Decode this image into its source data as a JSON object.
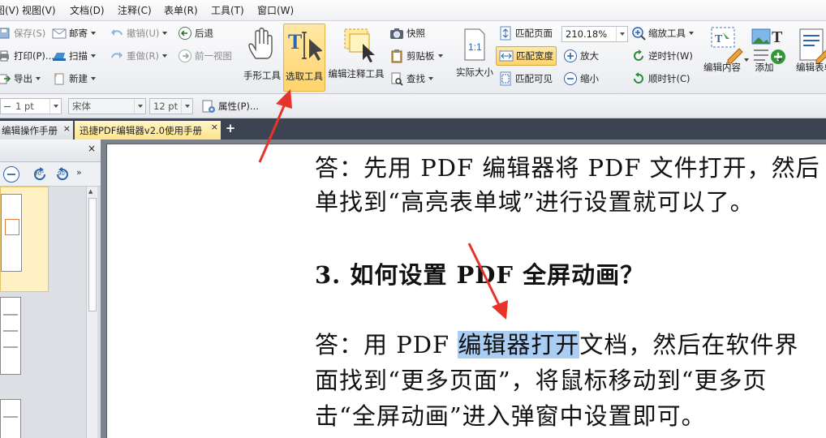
{
  "menubar": {
    "items": [
      "图(V)",
      "视图(V)",
      "文档(D)",
      "注释(C)",
      "表单(R)",
      "工具(T)",
      "窗口(W)"
    ]
  },
  "ribbon": {
    "file": {
      "save": "保存(S)",
      "print": "打印(P)...",
      "export": "导出",
      "mail": "邮寄",
      "scan": "扫描",
      "new": "新建"
    },
    "history": {
      "undo": "撤销(U)",
      "redo": "重做(R)",
      "back": "后退",
      "prev_view": "前一视图"
    },
    "tools": {
      "hand": "手形工具",
      "select": "选取工具",
      "annot_select": "编辑注释工具"
    },
    "clip": {
      "snapshot": "快照",
      "clipboard": "剪贴板",
      "find": "查找"
    },
    "view": {
      "actual_size": "实际大小",
      "fit_page": "匹配页面",
      "fit_width": "匹配宽度",
      "fit_visible": "匹配可见",
      "zoom_value": "210.18%",
      "zoom_tool": "缩放工具",
      "zoom_in": "放大",
      "zoom_out": "缩小",
      "rotate_ccw": "逆时针(W)",
      "rotate_cw": "顺时针(C)"
    },
    "edit": {
      "edit_content": "编辑内容",
      "add": "添加",
      "edit_form": "编辑表单"
    }
  },
  "props": {
    "line_width": "1 pt",
    "font": "宋体",
    "font_size": "12 pt",
    "properties": "属性(P)..."
  },
  "tabs": [
    {
      "label": "编辑操作手册",
      "active": false
    },
    {
      "label": "迅捷PDF编辑器v2.0使用手册",
      "active": true
    }
  ],
  "sidepanel": {
    "close": "×",
    "rot_left": "90°",
    "rot_right": "90°"
  },
  "document": {
    "answer1_line1": "答：先用 PDF 编辑器将 PDF 文件打开，然后",
    "answer1_line2": "单找到“高亮表单域”进行设置就可以了。",
    "heading": "3.  如何设置 PDF 全屏动画？",
    "answer2_pre": "答：用 PDF ",
    "answer2_highlight": "编辑器打开",
    "answer2_post": "文档，然后在软件界",
    "answer2_line2": "面找到“更多页面”，将鼠标移动到“更多页",
    "answer2_line3": "击“全屏动画”进入弹窗中设置即可。"
  },
  "colors": {
    "annotation_arrow": "#e8322c",
    "highlight": "#a9cdf3",
    "selected_tool": "#ffd36b"
  }
}
